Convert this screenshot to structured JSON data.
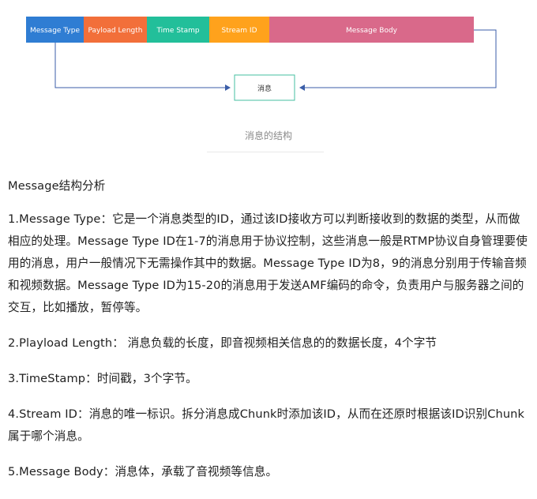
{
  "diagram": {
    "fields": [
      {
        "label": "Message Type",
        "color": "#2f7dd3"
      },
      {
        "label": "Payload Length",
        "color": "#f26f3a"
      },
      {
        "label": "Time Stamp",
        "color": "#22bf9a"
      },
      {
        "label": "Stream ID",
        "color": "#ffa21c"
      },
      {
        "label": "Message Body",
        "color": "#d9698a"
      }
    ],
    "target_label": "消息",
    "target_border_color": "#46bfa0",
    "arrow_color": "#3b5ea8"
  },
  "caption": "消息的结构",
  "heading": "Message结构分析",
  "items": [
    "1.Message Type：它是一个消息类型的ID，通过该ID接收方可以判断接收到的数据的类型，从而做相应的处理。Message Type ID在1-7的消息用于协议控制，这些消息一般是RTMP协议自身管理要使用的消息，用户一般情况下无需操作其中的数据。Message Type ID为8，9的消息分别用于传输音频和视频数据。Message Type ID为15-20的消息用于发送AMF编码的命令，负责用户与服务器之间的交互，比如播放，暂停等。",
    "2.Playload Length： 消息负载的长度，即音视频相关信息的的数据长度，4个字节",
    "3.TimeStamp：时间戳，3个字节。",
    "4.Stream ID：消息的唯一标识。拆分消息成Chunk时添加该ID，从而在还原时根据该ID识别Chunk属于哪个消息。",
    "5.Message Body：消息体，承载了音视频等信息。"
  ]
}
